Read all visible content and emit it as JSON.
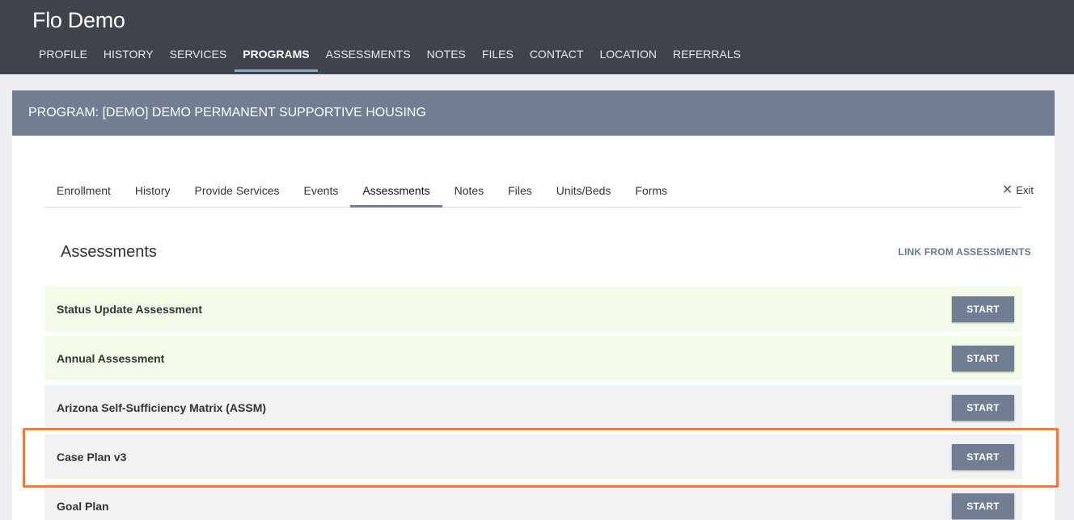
{
  "header": {
    "client_name": "Flo Demo",
    "nav": [
      "PROFILE",
      "HISTORY",
      "SERVICES",
      "PROGRAMS",
      "ASSESSMENTS",
      "NOTES",
      "FILES",
      "CONTACT",
      "LOCATION",
      "REFERRALS"
    ],
    "active_nav": "PROGRAMS"
  },
  "program": {
    "title": "PROGRAM: [DEMO] DEMO PERMANENT SUPPORTIVE HOUSING",
    "tabs": [
      "Enrollment",
      "History",
      "Provide Services",
      "Events",
      "Assessments",
      "Notes",
      "Files",
      "Units/Beds",
      "Forms"
    ],
    "active_tab": "Assessments",
    "exit_label": "Exit"
  },
  "assessments": {
    "title": "Assessments",
    "link_label": "LINK FROM ASSESSMENTS",
    "start_label": "START",
    "rows": [
      {
        "name": "Status Update Assessment",
        "status_color": "#f2fce9"
      },
      {
        "name": "Annual Assessment",
        "status_color": "#f2fce9"
      },
      {
        "name": "Arizona Self-Sufficiency Matrix (ASSM)",
        "status_color": "#f1f2f4"
      },
      {
        "name": "Case Plan v3",
        "status_color": "#f1f2f4"
      },
      {
        "name": "Goal Plan",
        "status_color": "#f1f2f4"
      }
    ]
  },
  "colors": {
    "topbar": "#40434c",
    "accent": "#707d93",
    "highlight": "#f47a33"
  }
}
